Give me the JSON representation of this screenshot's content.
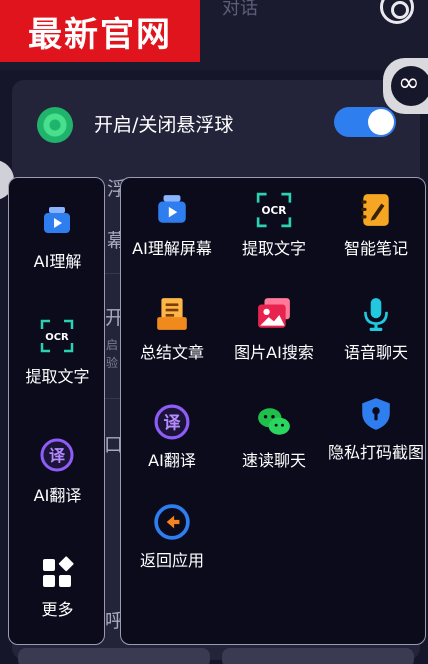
{
  "watermark": {
    "text": "最新官网"
  },
  "background": {
    "tab_partial": "对话",
    "toggle_label": "开启/关闭悬浮球",
    "toggle_on": true,
    "peek_1": "浮",
    "peek_2": "幕",
    "peek_3": "开",
    "peek_4": "启",
    "peek_5": "验",
    "peek_6": "口",
    "peek_7": "呼"
  },
  "left_panel": {
    "items": [
      {
        "label": "AI理解",
        "icon": "tv-play-icon"
      },
      {
        "label": "提取文字",
        "icon": "ocr-icon"
      },
      {
        "label": "AI翻译",
        "icon": "translate-icon"
      },
      {
        "label": "更多",
        "icon": "grid-more-icon"
      }
    ]
  },
  "right_panel": {
    "items": [
      {
        "label": "AI理解屏幕",
        "icon": "tv-play-icon"
      },
      {
        "label": "提取文字",
        "icon": "ocr-icon"
      },
      {
        "label": "智能笔记",
        "icon": "notebook-icon"
      },
      {
        "label": "总结文章",
        "icon": "document-icon"
      },
      {
        "label": "图片AI搜索",
        "icon": "image-search-icon"
      },
      {
        "label": "语音聊天",
        "icon": "microphone-icon"
      },
      {
        "label": "AI翻译",
        "icon": "translate-icon"
      },
      {
        "label": "速读聊天",
        "icon": "wechat-icon"
      },
      {
        "label": "隐私打码截图",
        "icon": "privacy-shield-icon"
      },
      {
        "label": "返回应用",
        "icon": "back-arrow-icon"
      }
    ]
  },
  "icon_labels": {
    "ocr": "OCR",
    "translate": "译"
  },
  "colors": {
    "accent_blue": "#2e7ef0",
    "panel_bg": "#0b0b1c",
    "watermark_red": "#e0141c",
    "ocr_teal": "#2bd1b1",
    "translate_purple": "#8e5cf6"
  }
}
